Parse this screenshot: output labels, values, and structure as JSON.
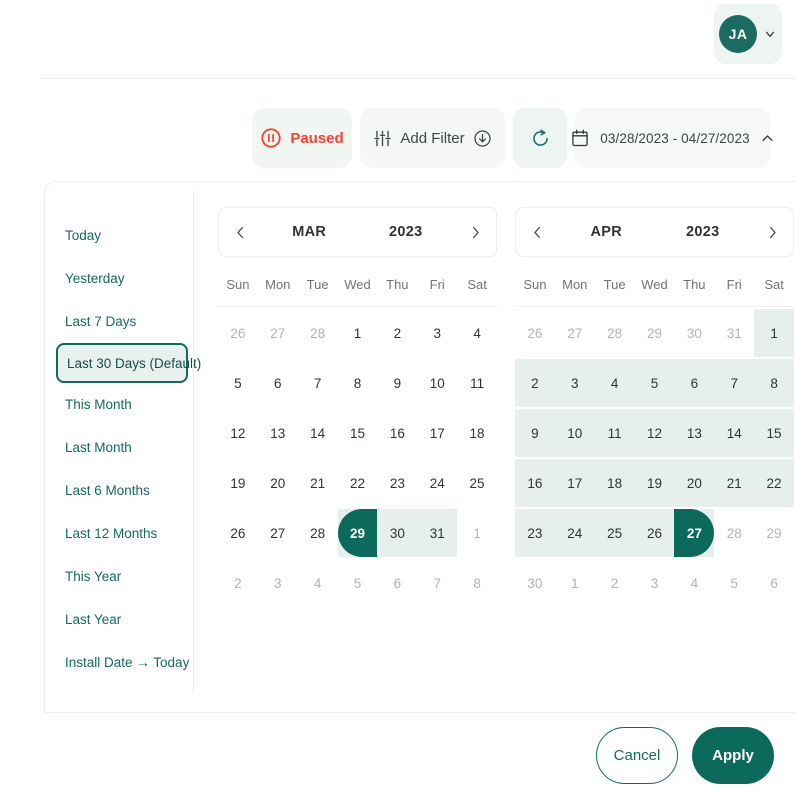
{
  "header": {
    "avatar_initials": "JA",
    "avatar_color": "#1b6b60",
    "chevron_icon": "chevron-down-icon"
  },
  "toolbar": {
    "paused_label": "Paused",
    "paused_color": "#f9402d",
    "pause_icon": "pause-circle-icon",
    "add_filter_label": "Add Filter",
    "filter_icon": "sliders-icon",
    "download_icon": "download-circle-icon",
    "refresh_icon": "refresh-icon",
    "refresh_color": "#1b7069",
    "calendar_icon": "calendar-icon",
    "date_range_value": "03/28/2023 - 04/27/2023",
    "collapse_icon": "chevron-up-icon"
  },
  "presets": [
    {
      "label": "Today",
      "selected": false
    },
    {
      "label": "Yesterday",
      "selected": false
    },
    {
      "label": "Last 7 Days",
      "selected": false
    },
    {
      "label": "Last 30 Days (Default)",
      "selected": true
    },
    {
      "label": "This Month",
      "selected": false
    },
    {
      "label": "Last Month",
      "selected": false
    },
    {
      "label": "Last 6 Months",
      "selected": false
    },
    {
      "label": "Last 12 Months",
      "selected": false
    },
    {
      "label": "This Year",
      "selected": false
    },
    {
      "label": "Last Year",
      "selected": false
    },
    {
      "label": "Install Date → Today",
      "selected": false
    }
  ],
  "dow": [
    "Sun",
    "Mon",
    "Tue",
    "Wed",
    "Thu",
    "Fri",
    "Sat"
  ],
  "calendars": [
    {
      "name": "march",
      "month": "MAR",
      "year": "2023",
      "prev_icon": "chevron-left-icon",
      "next_icon": "chevron-right-icon",
      "weeks": [
        [
          {
            "d": "26",
            "out": true
          },
          {
            "d": "27",
            "out": true
          },
          {
            "d": "28",
            "out": true
          },
          {
            "d": "1"
          },
          {
            "d": "2"
          },
          {
            "d": "3"
          },
          {
            "d": "4"
          }
        ],
        [
          {
            "d": "5"
          },
          {
            "d": "6"
          },
          {
            "d": "7"
          },
          {
            "d": "8"
          },
          {
            "d": "9"
          },
          {
            "d": "10"
          },
          {
            "d": "11"
          }
        ],
        [
          {
            "d": "12"
          },
          {
            "d": "13"
          },
          {
            "d": "14"
          },
          {
            "d": "15"
          },
          {
            "d": "16"
          },
          {
            "d": "17"
          },
          {
            "d": "18"
          }
        ],
        [
          {
            "d": "19"
          },
          {
            "d": "20"
          },
          {
            "d": "21"
          },
          {
            "d": "22"
          },
          {
            "d": "23"
          },
          {
            "d": "24"
          },
          {
            "d": "25"
          }
        ],
        [
          {
            "d": "26"
          },
          {
            "d": "27"
          },
          {
            "d": "28"
          },
          {
            "d": "29",
            "state": "range-start"
          },
          {
            "d": "30",
            "state": "in-range"
          },
          {
            "d": "31",
            "state": "in-range"
          },
          {
            "d": "1",
            "out": true
          }
        ],
        [
          {
            "d": "2",
            "out": true
          },
          {
            "d": "3",
            "out": true
          },
          {
            "d": "4",
            "out": true
          },
          {
            "d": "5",
            "out": true
          },
          {
            "d": "6",
            "out": true
          },
          {
            "d": "7",
            "out": true
          },
          {
            "d": "8",
            "out": true
          }
        ]
      ]
    },
    {
      "name": "april",
      "month": "APR",
      "year": "2023",
      "prev_icon": "chevron-left-icon",
      "next_icon": "chevron-right-icon",
      "weeks": [
        [
          {
            "d": "26",
            "out": true
          },
          {
            "d": "27",
            "out": true
          },
          {
            "d": "28",
            "out": true
          },
          {
            "d": "29",
            "out": true
          },
          {
            "d": "30",
            "out": true
          },
          {
            "d": "31",
            "out": true
          },
          {
            "d": "1",
            "state": "in-range"
          }
        ],
        [
          {
            "d": "2",
            "state": "in-range"
          },
          {
            "d": "3",
            "state": "in-range"
          },
          {
            "d": "4",
            "state": "in-range"
          },
          {
            "d": "5",
            "state": "in-range"
          },
          {
            "d": "6",
            "state": "in-range"
          },
          {
            "d": "7",
            "state": "in-range"
          },
          {
            "d": "8",
            "state": "in-range"
          }
        ],
        [
          {
            "d": "9",
            "state": "in-range"
          },
          {
            "d": "10",
            "state": "in-range"
          },
          {
            "d": "11",
            "state": "in-range"
          },
          {
            "d": "12",
            "state": "in-range"
          },
          {
            "d": "13",
            "state": "in-range"
          },
          {
            "d": "14",
            "state": "in-range"
          },
          {
            "d": "15",
            "state": "in-range"
          }
        ],
        [
          {
            "d": "16",
            "state": "in-range"
          },
          {
            "d": "17",
            "state": "in-range"
          },
          {
            "d": "18",
            "state": "in-range"
          },
          {
            "d": "19",
            "state": "in-range"
          },
          {
            "d": "20",
            "state": "in-range"
          },
          {
            "d": "21",
            "state": "in-range"
          },
          {
            "d": "22",
            "state": "in-range"
          }
        ],
        [
          {
            "d": "23",
            "state": "in-range"
          },
          {
            "d": "24",
            "state": "in-range"
          },
          {
            "d": "25",
            "state": "in-range"
          },
          {
            "d": "26",
            "state": "in-range"
          },
          {
            "d": "27",
            "state": "range-end"
          },
          {
            "d": "28",
            "out": true
          },
          {
            "d": "29",
            "out": true
          }
        ],
        [
          {
            "d": "30",
            "out": true
          },
          {
            "d": "1",
            "out": true
          },
          {
            "d": "2",
            "out": true
          },
          {
            "d": "3",
            "out": true
          },
          {
            "d": "4",
            "out": true
          },
          {
            "d": "5",
            "out": true
          },
          {
            "d": "6",
            "out": true
          }
        ]
      ]
    }
  ],
  "footer": {
    "cancel_label": "Cancel",
    "apply_label": "Apply",
    "apply_color": "#0c6a5c"
  }
}
